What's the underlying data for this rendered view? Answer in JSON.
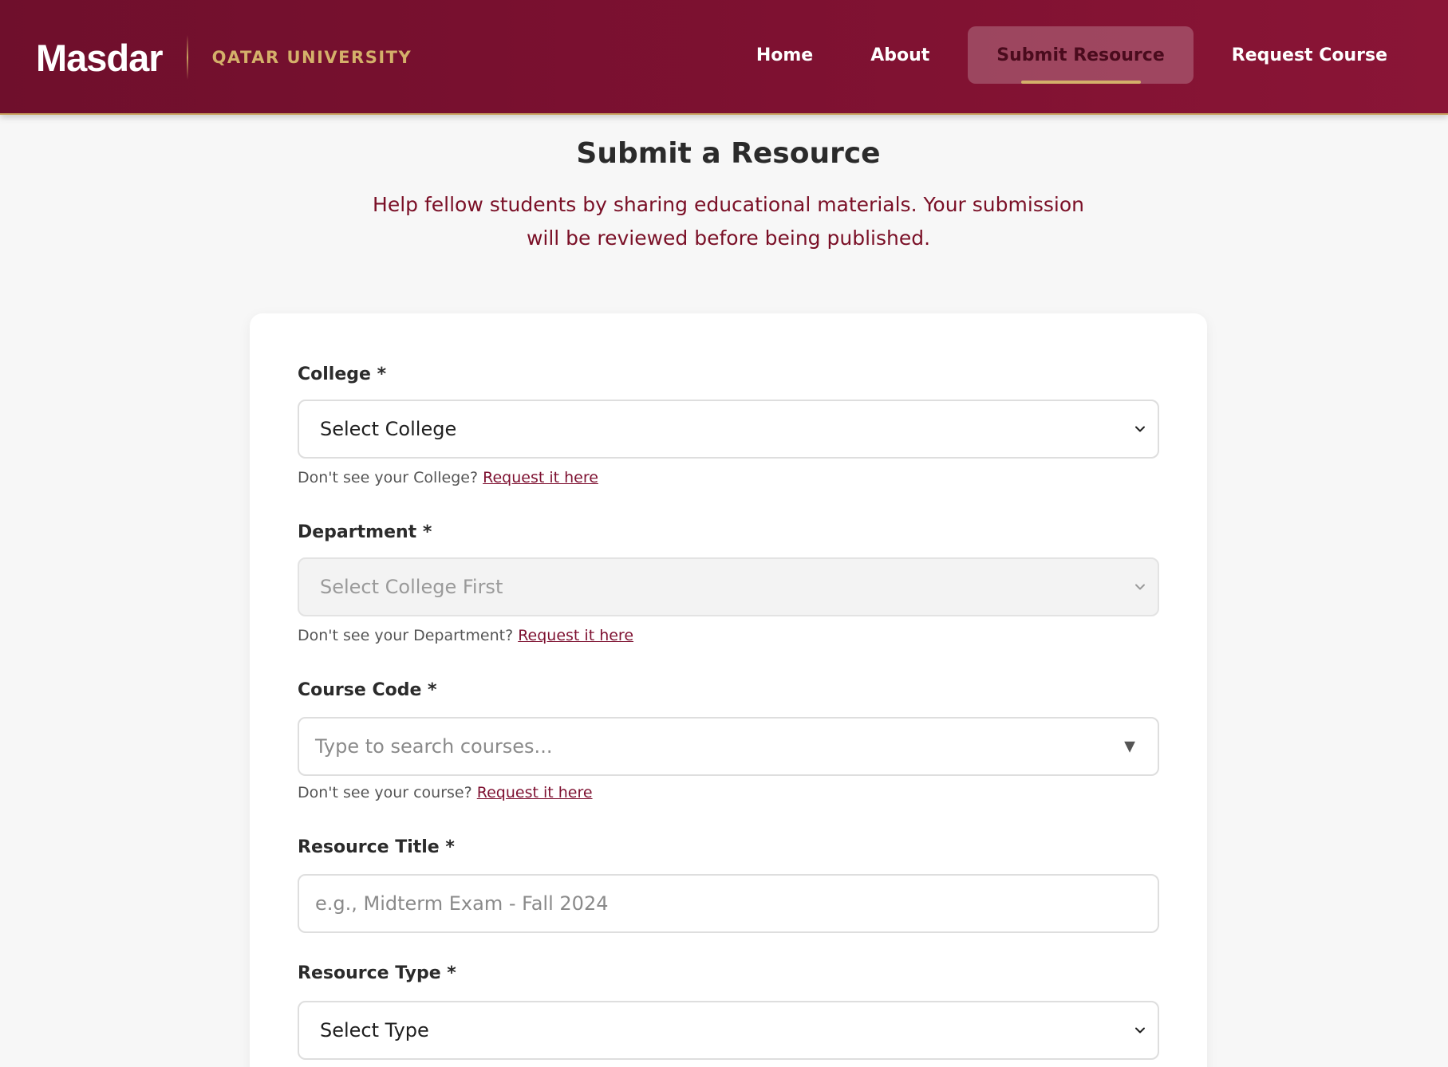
{
  "header": {
    "brand": "Masdar",
    "university": "QATAR UNIVERSITY",
    "nav": [
      {
        "label": "Home",
        "active": false
      },
      {
        "label": "About",
        "active": false
      },
      {
        "label": "Submit Resource",
        "active": true
      },
      {
        "label": "Request Course",
        "active": false
      }
    ]
  },
  "page": {
    "title": "Submit a Resource",
    "subtitle": "Help fellow students by sharing educational materials. Your submission will be reviewed before being published."
  },
  "form": {
    "college": {
      "label": "College *",
      "value": "Select College",
      "helper": "Don't see your College?",
      "link": "Request it here"
    },
    "department": {
      "label": "Department *",
      "value": "Select College First",
      "disabled": true,
      "helper": "Don't see your Department?",
      "link": "Request it here"
    },
    "course_code": {
      "label": "Course Code *",
      "placeholder": "Type to search courses...",
      "helper": "Don't see your course?",
      "link": "Request it here"
    },
    "resource_title": {
      "label": "Resource Title *",
      "placeholder": "e.g., Midterm Exam - Fall 2024"
    },
    "resource_type": {
      "label": "Resource Type *",
      "value": "Select Type"
    }
  },
  "colors": {
    "brand": "#7e1131",
    "accent_gold": "#d4b06a",
    "link": "#7e1131"
  },
  "icons": {
    "select_arrow": "chevron-down-icon",
    "combobox_arrow": "triangle-down-icon"
  }
}
